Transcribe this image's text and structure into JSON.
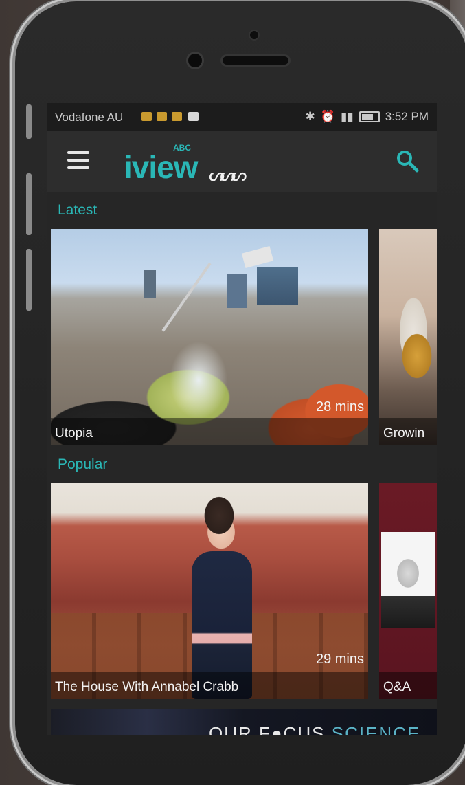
{
  "status_bar": {
    "carrier": "Vodafone AU",
    "right_icons": [
      "bluetooth-icon",
      "alarm-icon",
      "signal-icon",
      "battery-icon"
    ],
    "time": "3:52 PM"
  },
  "app_bar": {
    "logo_small": "ABC",
    "logo_main": "iview",
    "abc_mark": "ᔕᔕᔕ",
    "menu_icon": "hamburger-menu-icon",
    "search_icon": "search-icon"
  },
  "sections": {
    "latest": {
      "title": "Latest",
      "items": [
        {
          "title": "Utopia",
          "duration": "28 mins"
        },
        {
          "title": "Growin"
        }
      ]
    },
    "popular": {
      "title": "Popular",
      "items": [
        {
          "title": "The House With Annabel Crabb",
          "duration": "29 mins"
        },
        {
          "title": "Q&A"
        }
      ]
    }
  },
  "banner": {
    "prefix": "OUR F",
    "middle": "CUS",
    "suffix": "SCIENCE"
  },
  "colors": {
    "accent": "#2ab7b6",
    "background": "#262626",
    "appbar": "#2d2d2d"
  }
}
